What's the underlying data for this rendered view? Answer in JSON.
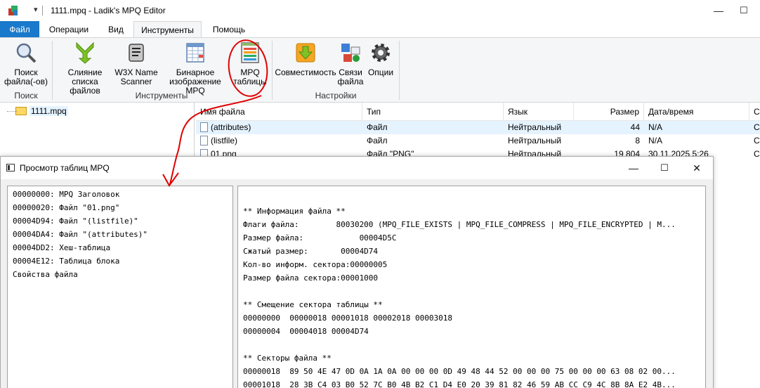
{
  "window": {
    "title": "1111.mpq - Ladik's MPQ Editor",
    "qa_arrow": "▾",
    "minimize": "—",
    "maximize": "☐",
    "close": "✕"
  },
  "ribbon": {
    "tabs": [
      {
        "label": "Файл"
      },
      {
        "label": "Операции"
      },
      {
        "label": "Вид"
      },
      {
        "label": "Инструменты"
      },
      {
        "label": "Помощь"
      }
    ],
    "buttons": {
      "search": [
        "Поиск",
        "файла(-ов)"
      ],
      "merge": [
        "Слияние",
        "списка файлов"
      ],
      "w3x": [
        "W3X Name",
        "Scanner"
      ],
      "binary": [
        "Бинарное",
        "изображение MPQ"
      ],
      "mpqtables": [
        "MPQ",
        "таблицы"
      ],
      "compat": [
        "Совместимость"
      ],
      "assoc": [
        "Связи",
        "файла"
      ],
      "options": [
        "Опции"
      ]
    },
    "groups": {
      "search": "Поиск",
      "tools": "Инструменты",
      "settings": "Настройки"
    }
  },
  "tree": {
    "root": "1111.mpq"
  },
  "filelist": {
    "columns": [
      "Имя файла",
      "Тип",
      "Язык",
      "Размер",
      "Дата/время",
      "С"
    ],
    "rows": [
      {
        "name": "(attributes)",
        "type": "Файл",
        "lang": "Нейтральный",
        "size": "44",
        "date": "N/A",
        "extra": "C"
      },
      {
        "name": "(listfile)",
        "type": "Файл",
        "lang": "Нейтральный",
        "size": "8",
        "date": "N/A",
        "extra": "C"
      },
      {
        "name": "01.png",
        "type": "Файл \"PNG\"",
        "lang": "Нейтральный",
        "size": "19 804",
        "date": "30.11.2025 5:26",
        "extra": "C"
      }
    ]
  },
  "popup": {
    "title": "Просмотр таблиц MPQ",
    "minimize": "—",
    "maximize": "☐",
    "close": "✕",
    "left_items": [
      "00000000: MPQ Заголовок",
      "00000020: Файл \"01.png\"",
      "00004D94: Файл \"(listfile)\"",
      "00004DA4: Файл \"(attributes)\"",
      "00004DD2: Хеш-таблица",
      "00004E12: Таблица блока",
      "Свойства файла"
    ],
    "right_lines": [
      "",
      "** Информация файла **",
      "Флаги файла:        80030200 (MPQ_FILE_EXISTS | MPQ_FILE_COMPRESS | MPQ_FILE_ENCRYPTED | M...",
      "Размер файла:            00004D5C",
      "Сжатый размер:       00004D74",
      "Кол-во информ. сектора:00000005",
      "Размер файла сектора:00001000",
      "",
      "** Смещение сектора таблицы **",
      "00000000  00000018 00001018 00002018 00003018",
      "00000004  00004018 00004D74",
      "",
      "** Секторы файла **",
      "00000018  89 50 4E 47 0D 0A 1A 0A 00 00 00 0D 49 48 44 52 00 00 00 75 00 00 00 63 08 02 00...",
      "00001018  28 3B C4 03 B0 52 7C B0 4B B2 C1 D4 E0 20 39 81 82 46 59 AB CC C9 4C 8B 8A E2 4B..."
    ]
  },
  "colors": {
    "file_tab": "#1979ca",
    "annotation": "#e00000"
  }
}
